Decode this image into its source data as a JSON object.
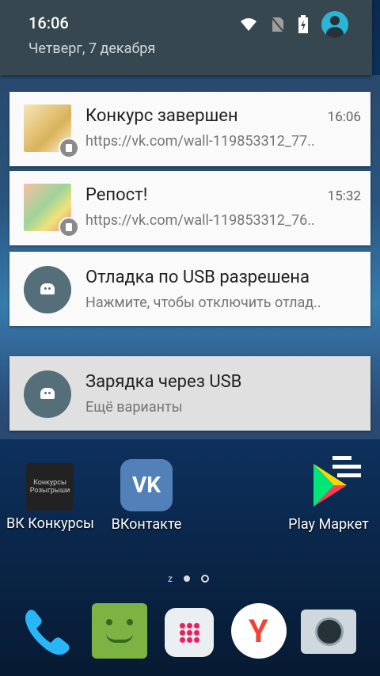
{
  "status": {
    "time": "16:06",
    "date": "Четверг, 7 декабря"
  },
  "notifications": [
    {
      "title": "Конкурс завершен",
      "text": "https://vk.com/wall-119853312_77..",
      "time": "16:06"
    },
    {
      "title": "Репост!",
      "text": "https://vk.com/wall-119853312_76..",
      "time": "15:32"
    },
    {
      "title": "Отладка по USB разрешена",
      "text": "Нажмите, чтобы отключить отлад.."
    },
    {
      "title": "Зарядка через USB",
      "text": "Ещё варианты"
    }
  ],
  "apps": [
    {
      "label": "ВК Конкурсы",
      "icon_text": "Конкурсы Розыгрыши"
    },
    {
      "label": "ВКонтакте"
    },
    {
      "label": "Play Маркет"
    }
  ],
  "vk_icon_text": "VK",
  "pager": {
    "label": "z"
  },
  "colors": {
    "shade": "#37474f",
    "accent": "#29b6d6",
    "card": "#fafafa"
  }
}
